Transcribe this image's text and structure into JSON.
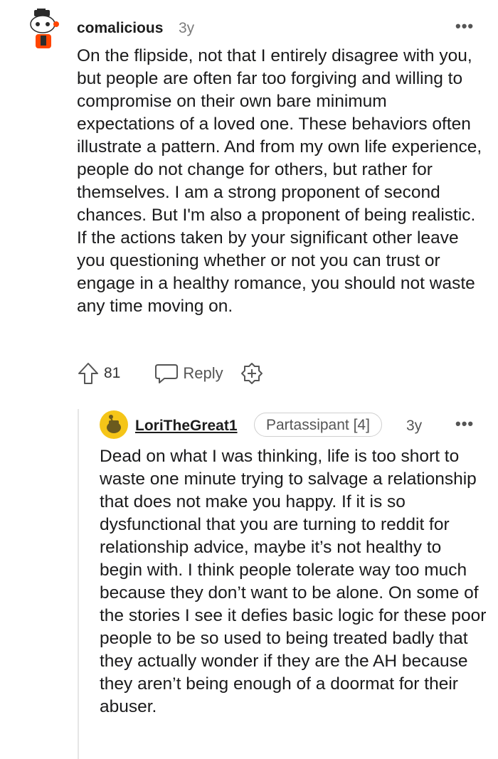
{
  "comment": {
    "username": "comalicious",
    "age": "3y",
    "more_label": "•••",
    "body": "On the flipside, not that I entirely disagree with you, but people are often far too forgiving and willing to compromise on their own bare minimum expectations of a loved one. These behaviors often illustrate a pattern. And from my own life experience, people do not change for others, but rather for themselves. I am a strong proponent of second chances. But I'm also a proponent of being realistic. If the actions taken by your significant other leave you questioning whether or not you can trust or engage in a healthy romance, you should not waste any time moving on.",
    "score": "81",
    "reply_label": "Reply",
    "icons": {
      "upvote": "upvote-arrow-icon",
      "reply": "speech-bubble-icon",
      "award": "award-plus-icon"
    }
  },
  "reply": {
    "username": "LoriTheGreat1",
    "flair": "Partassipant [4]",
    "age": "3y",
    "more_label": "•••",
    "body": "Dead on what I was thinking, life is too short to waste one minute trying to salvage a relationship that does not make you happy. If it is so dysfunctional that you are turning to reddit for relationship advice, maybe it’s not healthy to begin with. I think people tolerate way too much because they don’t want to be alone. On some of the stories I see it defies basic logic for these poor people to be so used to being treated badly that they actually wonder if they are the AH because they aren’t being enough of a doormat for their abuser."
  },
  "colors": {
    "text": "#1a1a1b",
    "meta": "#7c7c7c",
    "avatar_orange": "#ff4500",
    "avatar_yellow": "#f5c518"
  }
}
